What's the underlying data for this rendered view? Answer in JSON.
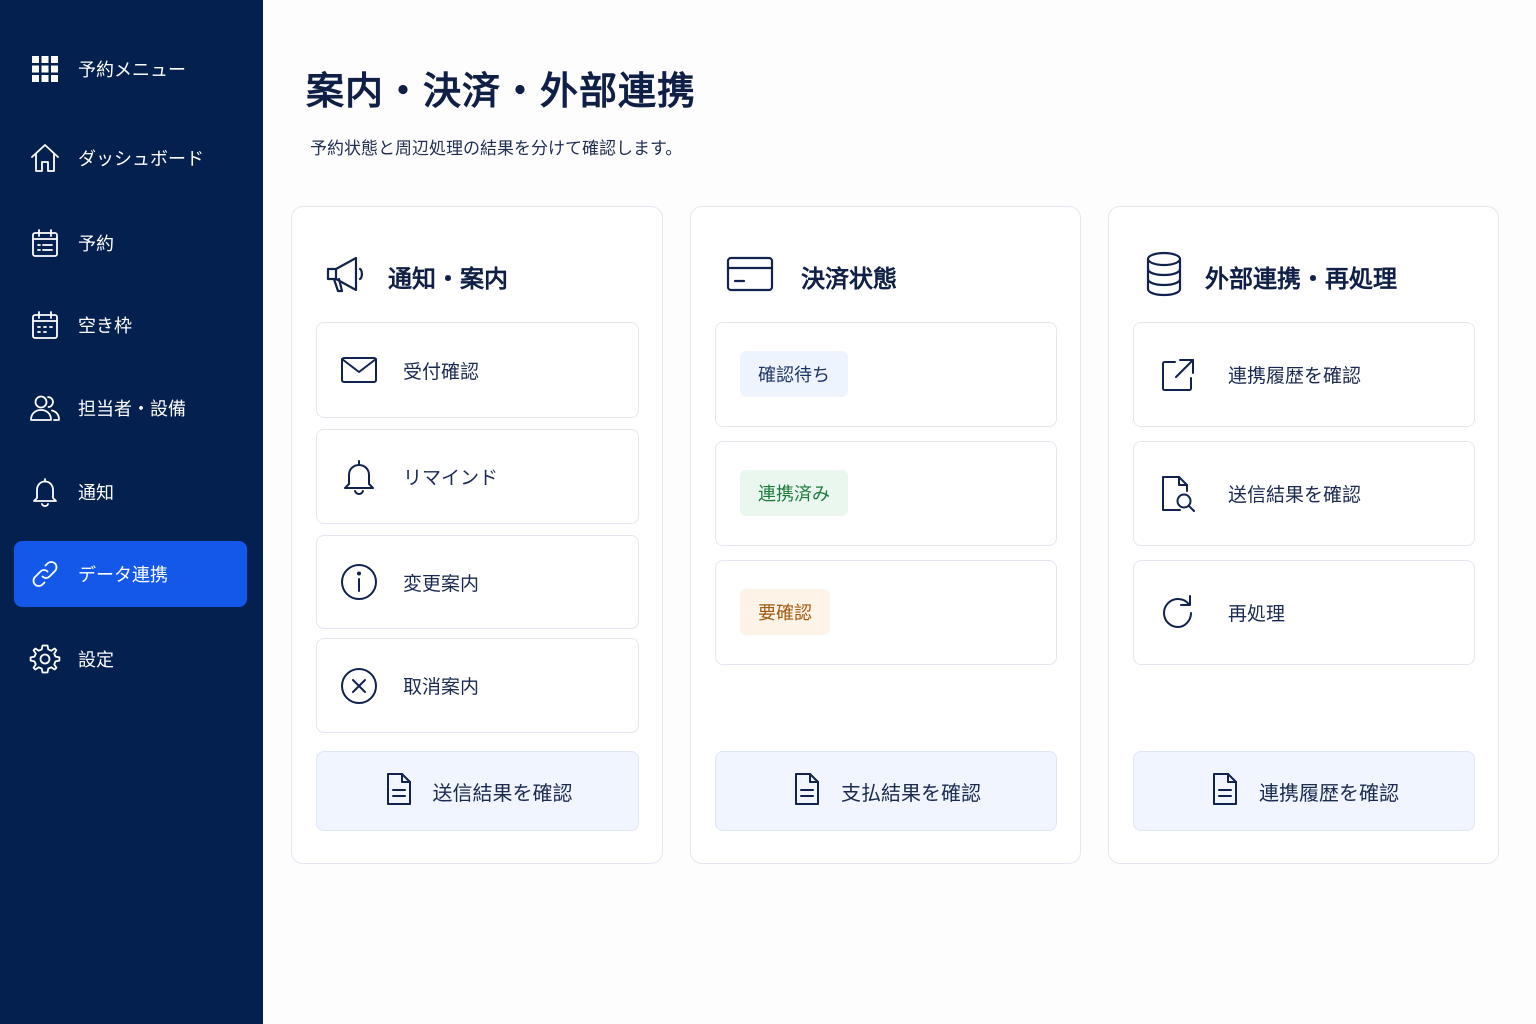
{
  "sidebar": {
    "items": [
      {
        "label": "予約メニュー",
        "icon": "grid-icon"
      },
      {
        "label": "ダッシュボード",
        "icon": "home-icon"
      },
      {
        "label": "予約",
        "icon": "calendar-list-icon"
      },
      {
        "label": "空き枠",
        "icon": "calendar-icon"
      },
      {
        "label": "担当者・設備",
        "icon": "users-icon"
      },
      {
        "label": "通知",
        "icon": "bell-icon"
      },
      {
        "label": "データ連携",
        "icon": "link-icon",
        "active": true
      },
      {
        "label": "設定",
        "icon": "gear-icon"
      }
    ]
  },
  "header": {
    "title": "案内・決済・外部連携",
    "subtitle": "予約状態と周辺処理の結果を分けて確認します。"
  },
  "cards": {
    "notifications": {
      "title": "通知・案内",
      "icon": "megaphone-icon",
      "items": [
        {
          "label": "受付確認",
          "icon": "mail-icon"
        },
        {
          "label": "リマインド",
          "icon": "bell-icon"
        },
        {
          "label": "変更案内",
          "icon": "info-icon"
        },
        {
          "label": "取消案内",
          "icon": "close-circle-icon"
        }
      ],
      "footer": "送信結果を確認"
    },
    "payment": {
      "title": "決済状態",
      "icon": "credit-card-icon",
      "statuses": [
        {
          "label": "確認待ち",
          "bg": "#eef4fd",
          "color": "#1d3566"
        },
        {
          "label": "連携済み",
          "bg": "#eaf7ee",
          "color": "#1d7a3a"
        },
        {
          "label": "要確認",
          "bg": "#fdf3e6",
          "color": "#a05a12"
        }
      ],
      "footer": "支払結果を確認"
    },
    "integration": {
      "title": "外部連携・再処理",
      "icon": "database-icon",
      "items": [
        {
          "label": "連携履歴を確認",
          "icon": "external-link-icon"
        },
        {
          "label": "送信結果を確認",
          "icon": "file-search-icon"
        },
        {
          "label": "再処理",
          "icon": "refresh-icon"
        }
      ],
      "footer": "連携履歴を確認"
    }
  },
  "colors": {
    "sidebar_bg": "#04204f",
    "active_bg": "#1358e8",
    "text_primary": "#0f1f45",
    "footer_bg": "#f0f5ff"
  }
}
